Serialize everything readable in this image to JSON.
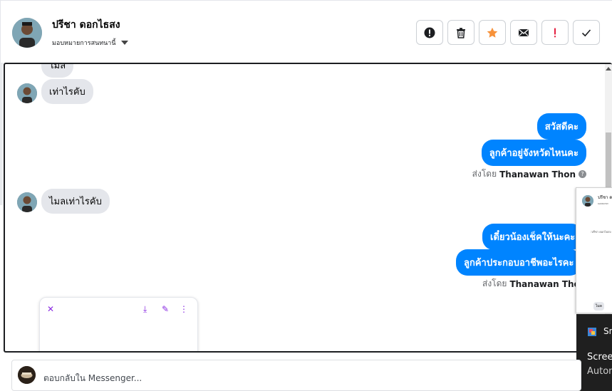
{
  "header": {
    "name": "ปรีชา ดอกไธสง",
    "assign_label": "มอบหมายการสนทนานี้",
    "actions": [
      {
        "icon": "alert-circle-icon",
        "label": "!"
      },
      {
        "icon": "trash-icon"
      },
      {
        "icon": "star-icon"
      },
      {
        "icon": "mail-icon"
      },
      {
        "icon": "important-icon",
        "label": "!"
      },
      {
        "icon": "check-icon"
      }
    ]
  },
  "colors": {
    "accent": "#0084ff",
    "star": "#f7923a",
    "important": "#e41e3f",
    "incoming_bubble": "#e4e6eb",
    "overlay_icons": "#8a2be2"
  },
  "messages": {
    "partial_top": "ไมล",
    "m1": "เท่าไรคับ",
    "m2": "สวัสดีคะ",
    "m3": "ลูกค้าอยู่จังหวัดไหนคะ",
    "sent_by_1_prefix": "ส่งโดย",
    "sent_by_1_name": "Thanawan Thon",
    "m4": "ไมลเท่าไรคับ",
    "m5": "เดี๋ยวน้องเช็คให้นะคะ",
    "m6": "ลูกค้าประกอบอาชีพอะไรคะ",
    "sent_by_2_prefix": "ส่งโดย",
    "sent_by_2_name": "Thanawan Thon"
  },
  "overlay": {
    "close": "✕",
    "download": "⤓",
    "edit": "✎",
    "more": "⋮"
  },
  "preview": {
    "name": "ปรีชา ด",
    "sub": "มอบหมายก",
    "text": ":ปรีชา ดอกไธสง",
    "bubble": "ไมล"
  },
  "toast": {
    "app": "Sn",
    "title": "Screen",
    "body": "Autom"
  },
  "reply": {
    "placeholder": "ตอบกลับใน Messenger..."
  }
}
